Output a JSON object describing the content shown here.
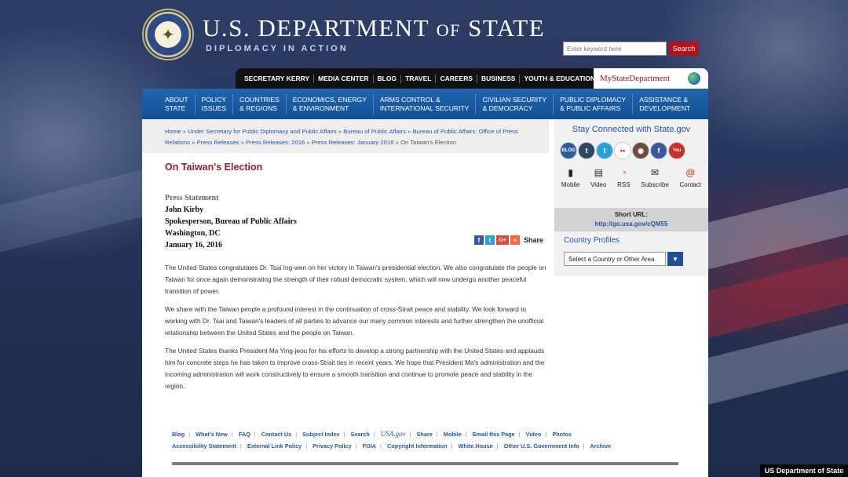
{
  "header": {
    "title_main": "U.S. DEPARTMENT",
    "title_of": "OF",
    "title_end": "STATE",
    "tagline": "DIPLOMACY IN ACTION",
    "search_placeholder": "Enter keyword here",
    "search_button": "Search"
  },
  "topnav": [
    "SECRETARY KERRY",
    "MEDIA CENTER",
    "BLOG",
    "TRAVEL",
    "CAREERS",
    "BUSINESS",
    "YOUTH & EDUCATION"
  ],
  "mystate": "MyStateDepartment",
  "mainnav": [
    "ABOUT\nSTATE",
    "POLICY\nISSUES",
    "COUNTRIES\n& REGIONS",
    "ECONOMICS, ENERGY\n& ENVIRONMENT",
    "ARMS CONTROL &\nINTERNATIONAL SECURITY",
    "CIVILIAN SECURITY\n& DEMOCRACY",
    "PUBLIC DIPLOMACY\n& PUBLIC AFFAIRS",
    "ASSISTANCE &\nDEVELOPMENT"
  ],
  "breadcrumb": {
    "items": [
      "Home",
      "Under Secretary for Public Diplomacy and Public Affairs",
      "Bureau of Public Affairs",
      "Bureau of Public Affairs: Office of Press Relations",
      "Press Releases",
      "Press Releases: 2016",
      "Press Releases: January 2016"
    ],
    "current": "On Taiwan's Election"
  },
  "article": {
    "title": "On Taiwan's Election",
    "type": "Press Statement",
    "author": "John Kirby",
    "role": "Spokesperson, Bureau of Public Affairs",
    "place": "Washington, DC",
    "date": "January 16, 2016",
    "share_label": "Share",
    "paragraphs": [
      "The United States congratulates Dr. Tsai Ing-wen on her victory in Taiwan's presidential election.  We also congratulate the people on Taiwan for once again demonstrating the strength of their robust democratic system, which will now undergo another peaceful transition of power.",
      "We share with the Taiwan people a profound interest in the continuation of cross-Strait peace and stability.  We look forward to working with Dr. Tsai and Taiwan's leaders of all parties to advance our many common interests and further strengthen the unofficial relationship between the United States and the people on Taiwan.",
      "The United States thanks President Ma Ying-jeou for his efforts to develop a strong partnership with the United States and applauds him for concrete steps he has taken to improve cross-Strait ties in recent years.  We hope that President Ma's administration and the incoming administration will work constructively to ensure a smooth transition and continue to promote peace and stability in the region."
    ]
  },
  "sidebar": {
    "stay_connected": "Stay Connected with State.gov",
    "social_icons": [
      {
        "name": "blog-icon",
        "glyph": "BLOG",
        "color": "#2e5b9a"
      },
      {
        "name": "tumblr-icon",
        "glyph": "t",
        "color": "#2c4762"
      },
      {
        "name": "twitter-icon",
        "glyph": "t",
        "color": "#2aa0d8"
      },
      {
        "name": "flickr-icon",
        "glyph": "••",
        "color": "#ffffff"
      },
      {
        "name": "instagram-icon",
        "glyph": "◉",
        "color": "#6e4d3a"
      },
      {
        "name": "facebook-icon",
        "glyph": "f",
        "color": "#3b5998"
      },
      {
        "name": "youtube-icon",
        "glyph": "You",
        "color": "#c4302b"
      }
    ],
    "sub_icons": [
      {
        "label": "Mobile",
        "icon": "mobile-icon",
        "glyph": "▮"
      },
      {
        "label": "Video",
        "icon": "video-icon",
        "glyph": "▤"
      },
      {
        "label": "RSS",
        "icon": "rss-icon",
        "glyph": "◔"
      },
      {
        "label": "Subscribe",
        "icon": "subscribe-icon",
        "glyph": "✉"
      },
      {
        "label": "Contact",
        "icon": "contact-icon",
        "glyph": "@"
      }
    ],
    "short_url_label": "Short URL:",
    "short_url": "http://go.usa.gov/cQM55",
    "country_profiles": "Country Profiles",
    "country_select": "Select a Country or Other Area"
  },
  "footer": {
    "row1": [
      "Blog",
      "What's New",
      "FAQ",
      "Contact Us",
      "Subject Index",
      "Search",
      "USA.gov",
      "Share",
      "Mobile",
      "Email this Page",
      "Video",
      "Photos"
    ],
    "row2": [
      "Accessibility Statement",
      "External Link Policy",
      "Privacy Policy",
      "FOIA",
      "Copyright Information",
      "White House",
      "Other U.S. Government Info",
      "Archive"
    ]
  },
  "credit": "US Department of State",
  "colors": {
    "accent_red": "#b3121b",
    "nav_blue": "#1a5aa3",
    "title_red": "#a0182b",
    "link_blue": "#2356a3"
  }
}
